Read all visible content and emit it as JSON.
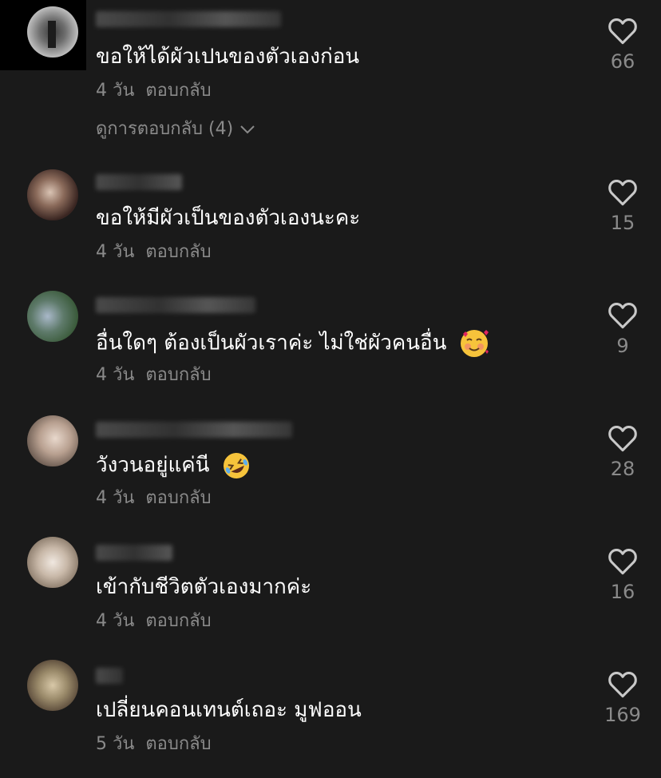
{
  "reply_label": "ตอบกลับ",
  "view_replies_label": "ดูการตอบกลับ (4)",
  "comments": [
    {
      "text": "ขอให้ได้ผัวเปนของตัวเองก่อน",
      "time": "4 วัน",
      "likes": "66"
    },
    {
      "text": "ขอให้มีผัวเป็นของตัวเองนะคะ",
      "time": "4 วัน",
      "likes": "15"
    },
    {
      "text": "อื่นใดๆ ต้องเป็นผัวเราค่ะ ไม่ใช่ผัวคนอื่น",
      "time": "4 วัน",
      "likes": "9",
      "emoji": "smiling-face-with-hearts-icon"
    },
    {
      "text": "วังวนอยู่แค่นี",
      "time": "4 วัน",
      "likes": "28",
      "emoji": "rolling-on-floor-laughing-icon"
    },
    {
      "text": "เข้ากับชีวิตตัวเองมากค่ะ",
      "time": "4 วัน",
      "likes": "16"
    },
    {
      "text": "เปลี่ยนคอนเทนต์เถอะ มูฟออน",
      "time": "5 วัน",
      "likes": "169"
    }
  ],
  "colors": {
    "background": "#1a1a1a",
    "text_primary": "#ffffff",
    "text_secondary": "#8a8a8a",
    "icon": "#c8c8c8"
  }
}
